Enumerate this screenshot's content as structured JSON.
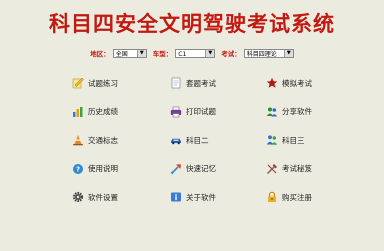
{
  "title": "科目四安全文明驾驶考试系统",
  "filters": {
    "region": {
      "label": "地区：",
      "value": "全国"
    },
    "car_type": {
      "label": "车型：",
      "value": "C1"
    },
    "exam": {
      "label": "考试：",
      "value": "科目四理论"
    }
  },
  "menu": [
    {
      "label": "试题练习",
      "icon": "pencil-icon"
    },
    {
      "label": "套题考试",
      "icon": "document-icon"
    },
    {
      "label": "模拟考试",
      "icon": "star-icon"
    },
    {
      "label": "历史成绩",
      "icon": "bar-chart-icon"
    },
    {
      "label": "打印试题",
      "icon": "printer-icon"
    },
    {
      "label": "分享软件",
      "icon": "users-icon"
    },
    {
      "label": "交通标志",
      "icon": "traffic-cone-icon"
    },
    {
      "label": "科目二",
      "icon": "car-icon"
    },
    {
      "label": "科目三",
      "icon": "people-icon"
    },
    {
      "label": "使用说明",
      "icon": "help-icon"
    },
    {
      "label": "快速记忆",
      "icon": "arrow-icon"
    },
    {
      "label": "考试秘笈",
      "icon": "tools-icon"
    },
    {
      "label": "软件设置",
      "icon": "gear-icon"
    },
    {
      "label": "关于软件",
      "icon": "info-icon"
    },
    {
      "label": "购买注册",
      "icon": "lock-icon"
    }
  ],
  "colors": {
    "background": "#ecebe0",
    "title": "#c21a10",
    "label": "#c21a10"
  }
}
